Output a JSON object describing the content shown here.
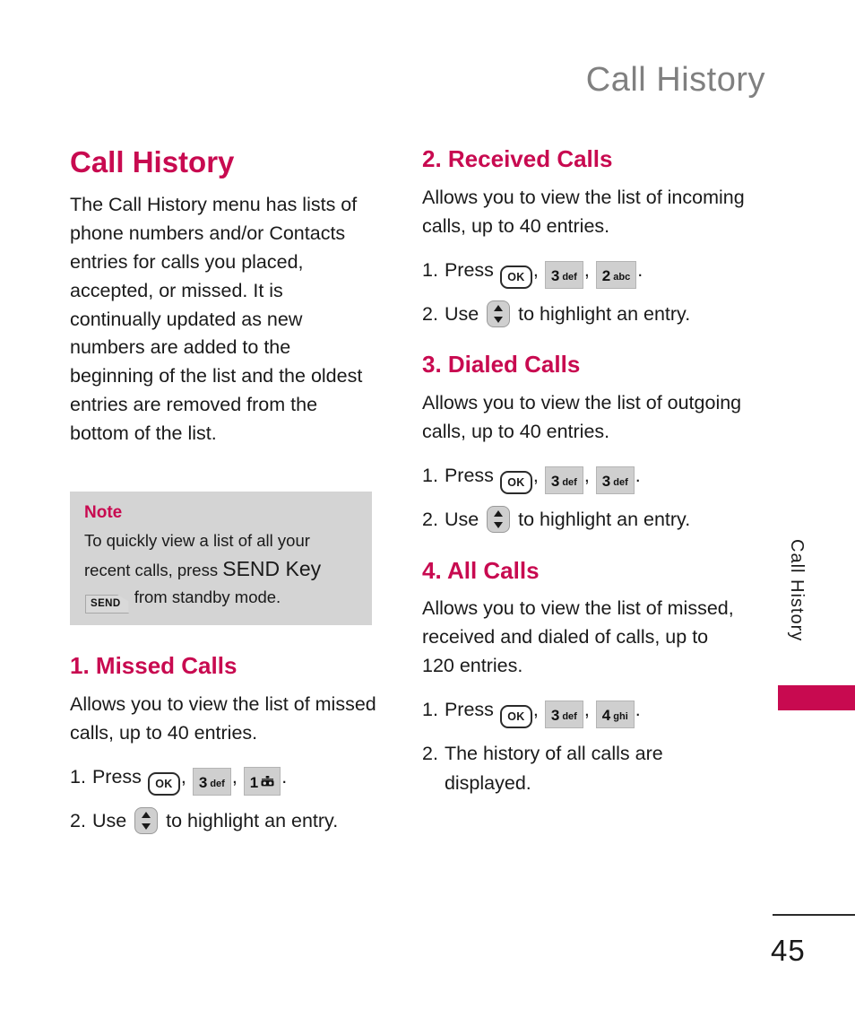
{
  "header": {
    "running_title": "Call History"
  },
  "left_column": {
    "title": "Call History",
    "intro": "The Call History menu has lists of phone numbers and/or Contacts entries for calls you placed, accepted, or missed. It is continually updated as new numbers are added to the beginning of the list and the oldest entries are removed from the bottom of the list.",
    "note": {
      "label": "Note",
      "text_before": "To quickly view a list of all your recent calls, press ",
      "send_key_words": "SEND Key",
      "send_icon_label": "SEND",
      "text_after": " from standby mode."
    },
    "section": {
      "title": "1. Missed Calls",
      "description": "Allows you to view the list of missed calls, up to 40 entries.",
      "steps": [
        {
          "num": "1.",
          "lead": "Press",
          "keys": [
            {
              "type": "ok",
              "label": "OK"
            },
            {
              "type": "num",
              "digit": "3",
              "sub": "def"
            },
            {
              "type": "num",
              "digit": "1",
              "sub": "voicemail-glyph"
            }
          ],
          "trail": "."
        },
        {
          "num": "2.",
          "lead": "Use",
          "keys": [
            {
              "type": "nav",
              "label": "up-down"
            }
          ],
          "trail": "to highlight an entry."
        }
      ]
    }
  },
  "right_column": {
    "sections": [
      {
        "title": "2. Received Calls",
        "description": "Allows you to view the list of incoming calls, up to 40 entries.",
        "steps": [
          {
            "num": "1.",
            "lead": "Press",
            "keys": [
              {
                "type": "ok",
                "label": "OK"
              },
              {
                "type": "num",
                "digit": "3",
                "sub": "def"
              },
              {
                "type": "num",
                "digit": "2",
                "sub": "abc"
              }
            ],
            "trail": "."
          },
          {
            "num": "2.",
            "lead": "Use",
            "keys": [
              {
                "type": "nav",
                "label": "up-down"
              }
            ],
            "trail": "to highlight an entry."
          }
        ]
      },
      {
        "title": "3. Dialed Calls",
        "description": "Allows you to view the list of outgoing calls, up to 40 entries.",
        "steps": [
          {
            "num": "1.",
            "lead": "Press",
            "keys": [
              {
                "type": "ok",
                "label": "OK"
              },
              {
                "type": "num",
                "digit": "3",
                "sub": "def"
              },
              {
                "type": "num",
                "digit": "3",
                "sub": "def"
              }
            ],
            "trail": "."
          },
          {
            "num": "2.",
            "lead": "Use",
            "keys": [
              {
                "type": "nav",
                "label": "up-down"
              }
            ],
            "trail": "to highlight an entry."
          }
        ]
      },
      {
        "title": "4. All Calls",
        "description": "Allows you to view the list of missed, received and dialed of calls, up to 120 entries.",
        "steps": [
          {
            "num": "1.",
            "lead": "Press",
            "keys": [
              {
                "type": "ok",
                "label": "OK"
              },
              {
                "type": "num",
                "digit": "3",
                "sub": "def"
              },
              {
                "type": "num",
                "digit": "4",
                "sub": "ghi"
              }
            ],
            "trail": "."
          },
          {
            "num": "2.",
            "lead": "",
            "keys": [],
            "trail": "The history of all calls are displayed."
          }
        ]
      }
    ]
  },
  "thumb_tab": {
    "label": "Call History",
    "color": "#c80a50"
  },
  "footer": {
    "page_number": "45"
  },
  "colors": {
    "accent": "#c80a50",
    "running_header": "#808080",
    "note_background": "#d4d4d4",
    "body_text": "#1a1a1a"
  }
}
